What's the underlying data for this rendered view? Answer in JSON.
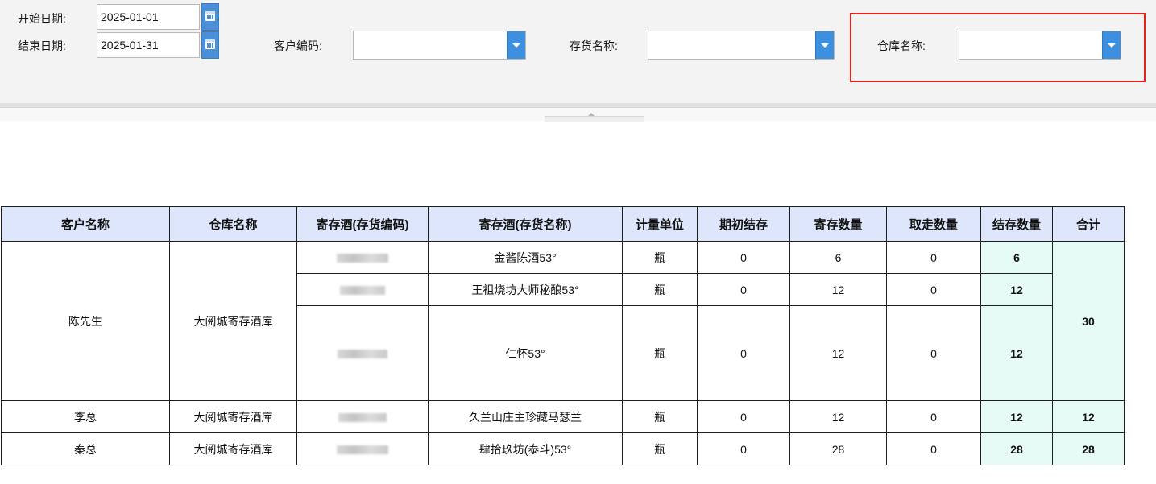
{
  "filters": {
    "start_label": "开始日期:",
    "start_value": "2025-01-01",
    "end_label": "结束日期:",
    "end_value": "2025-01-31",
    "customer_label": "客户编码:",
    "customer_value": "",
    "item_label": "存货名称:",
    "item_value": "",
    "warehouse_label": "仓库名称:",
    "warehouse_value": ""
  },
  "icons": {
    "calendar": "calendar-icon",
    "dropdown": "chevron-down-icon"
  },
  "colors": {
    "header_bg": "#dde6fb",
    "highlight_col": "#e6faf6",
    "accent": "#3d8fe0",
    "annotation_box": "#e8211f"
  },
  "table": {
    "columns": [
      "客户名称",
      "仓库名称",
      "寄存酒(存货编码)",
      "寄存酒(存货名称)",
      "计量单位",
      "期初结存",
      "寄存数量",
      "取走数量",
      "结存数量",
      "合计"
    ],
    "groups": [
      {
        "customer": "陈先生",
        "warehouse": "大阅城寄存酒库",
        "total": "30",
        "rows": [
          {
            "code": "",
            "name": "金酱陈酒53°",
            "unit": "瓶",
            "opening": "0",
            "deposit": "6",
            "taken": "0",
            "balance": "6"
          },
          {
            "code": "",
            "name": "王祖烧坊大师秘酿53°",
            "unit": "瓶",
            "opening": "0",
            "deposit": "12",
            "taken": "0",
            "balance": "12"
          },
          {
            "code": "",
            "name": "仁怀53°",
            "unit": "瓶",
            "opening": "0",
            "deposit": "12",
            "taken": "0",
            "balance": "12"
          }
        ]
      },
      {
        "customer": "李总",
        "warehouse": "大阅城寄存酒库",
        "total": "12",
        "rows": [
          {
            "code": "",
            "name": "久兰山庄主珍藏马瑟兰",
            "unit": "瓶",
            "opening": "0",
            "deposit": "12",
            "taken": "0",
            "balance": "12"
          }
        ]
      },
      {
        "customer": "秦总",
        "warehouse": "大阅城寄存酒库",
        "total": "28",
        "rows": [
          {
            "code": "",
            "name": "肆拾玖坊(泰斗)53°",
            "unit": "瓶",
            "opening": "0",
            "deposit": "28",
            "taken": "0",
            "balance": "28"
          }
        ]
      }
    ]
  }
}
